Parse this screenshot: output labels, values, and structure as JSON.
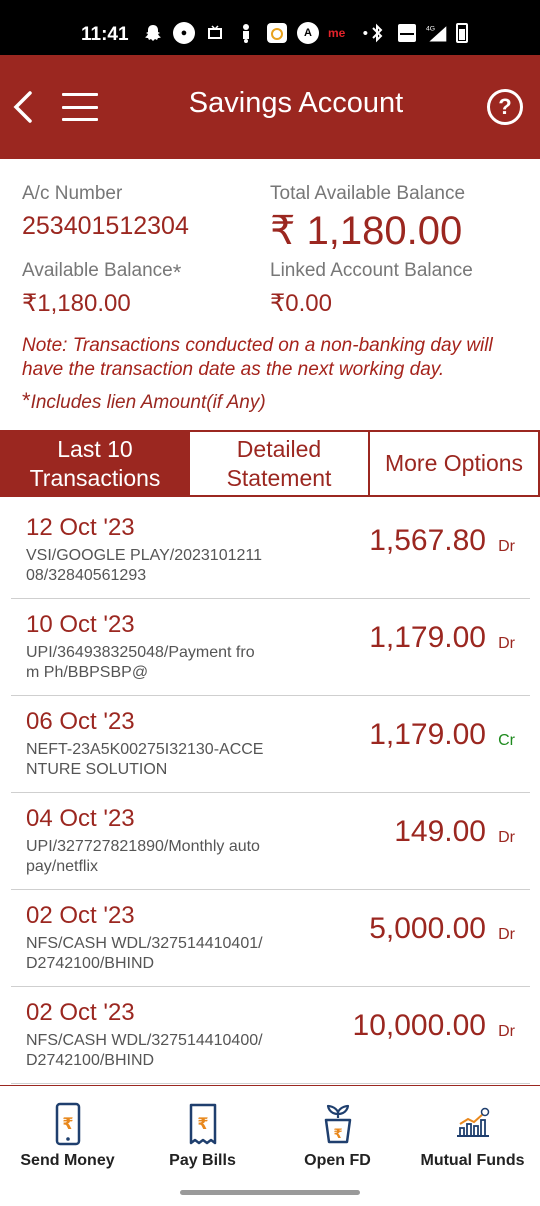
{
  "status_bar": {
    "time": "11:41",
    "icons_left": [
      "snapchat-icon",
      "app-icon",
      "tv-icon",
      "scooter-icon",
      "app-icon",
      "app-icon",
      "me-icon",
      "dot-icon"
    ],
    "me_text": "me",
    "icons_right": [
      "bluetooth-icon",
      "volte-icon",
      "signal-4g-icon",
      "battery-icon"
    ],
    "network": "4G"
  },
  "header": {
    "title": "Savings Account",
    "back_icon": "chevron-left-icon",
    "menu_icon": "hamburger-icon",
    "help_icon": "help-icon",
    "help_glyph": "?",
    "background_color": "#9b2720"
  },
  "account": {
    "number_label": "A/c Number",
    "number": "253401512304",
    "total_label": "Total Available Balance",
    "total_balance": "₹ 1,180.00",
    "available_label": "Available Balance",
    "available_star": "*",
    "available_balance": "₹1,180.00",
    "linked_label": "Linked Account Balance",
    "linked_balance": "₹0.00",
    "note": "Note: Transactions conducted on a non-banking day will have the transaction date as the next working day.",
    "lien_star": "*",
    "lien_note": "Includes lien Amount(if Any)"
  },
  "tabs": [
    {
      "label": "Last 10 Transactions",
      "active": true
    },
    {
      "label": "Detailed Statement",
      "active": false
    },
    {
      "label": "More Options",
      "active": false
    }
  ],
  "transactions": [
    {
      "date": "12 Oct '23",
      "description": "VSI/GOOGLE PLAY/202310121108/32840561293",
      "amount": "1,567.80",
      "type": "Dr"
    },
    {
      "date": "10 Oct '23",
      "description": "UPI/364938325048/Payment from Ph/BBPSBP@",
      "amount": "1,179.00",
      "type": "Dr"
    },
    {
      "date": "06 Oct '23",
      "description": "NEFT-23A5K00275I32130-ACCENTURE SOLUTION",
      "amount": "1,179.00",
      "type": "Cr"
    },
    {
      "date": "04 Oct '23",
      "description": "UPI/327727821890/Monthly autopay/netflix",
      "amount": "149.00",
      "type": "Dr"
    },
    {
      "date": "02 Oct '23",
      "description": "NFS/CASH WDL/327514410401/D2742100/BHIND",
      "amount": "5,000.00",
      "type": "Dr"
    },
    {
      "date": "02 Oct '23",
      "description": "NFS/CASH WDL/327514410400/D2742100/BHIND",
      "amount": "10,000.00",
      "type": "Dr"
    }
  ],
  "bottom_nav": [
    {
      "label": "Send Money",
      "icon": "phone-rupee-icon"
    },
    {
      "label": "Pay Bills",
      "icon": "bill-rupee-icon"
    },
    {
      "label": "Open FD",
      "icon": "plant-pot-rupee-icon"
    },
    {
      "label": "Mutual Funds",
      "icon": "growth-chart-icon"
    }
  ],
  "colors": {
    "brand": "#9b2720",
    "credit": "#1e8a1e",
    "icon_blue": "#1f3f6e",
    "icon_orange": "#e8881d"
  }
}
